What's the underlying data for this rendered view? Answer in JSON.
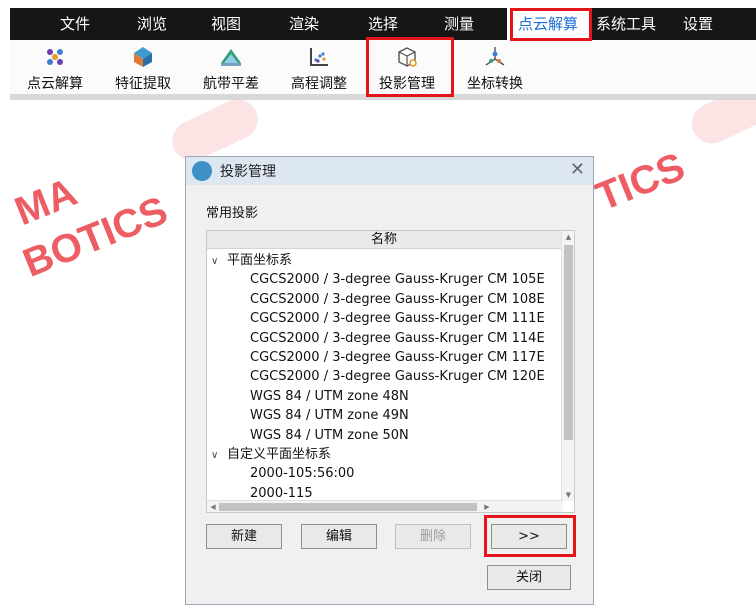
{
  "menu": {
    "items": [
      {
        "label": "文件"
      },
      {
        "label": "浏览"
      },
      {
        "label": "视图"
      },
      {
        "label": "渲染"
      },
      {
        "label": "选择"
      },
      {
        "label": "测量"
      },
      {
        "label": "点云解算",
        "active": true
      },
      {
        "label": "系统工具"
      },
      {
        "label": "设置"
      }
    ]
  },
  "ribbon": {
    "buttons": [
      {
        "label": "点云解算",
        "icon": "point-cloud-solve-icon"
      },
      {
        "label": "特征提取",
        "icon": "feature-extract-icon"
      },
      {
        "label": "航带平差",
        "icon": "strip-adjust-icon"
      },
      {
        "label": "高程调整",
        "icon": "elevation-adjust-icon"
      },
      {
        "label": "投影管理",
        "icon": "projection-manage-icon"
      },
      {
        "label": "坐标转换",
        "icon": "coordinate-transform-icon"
      }
    ]
  },
  "watermark": {
    "line1": "MA",
    "line2": "BOTICS",
    "line3": "TICS"
  },
  "dialog": {
    "title": "投影管理",
    "close_glyph": "✕",
    "section_label": "常用投影",
    "column_header": "名称",
    "groups": [
      {
        "label": "平面坐标系",
        "items": [
          "CGCS2000 / 3-degree Gauss-Kruger CM 105E",
          "CGCS2000 / 3-degree Gauss-Kruger CM 108E",
          "CGCS2000 / 3-degree Gauss-Kruger CM 111E",
          "CGCS2000 / 3-degree Gauss-Kruger CM 114E",
          "CGCS2000 / 3-degree Gauss-Kruger CM 117E",
          "CGCS2000 / 3-degree Gauss-Kruger CM 120E",
          "WGS 84 / UTM zone 48N",
          "WGS 84 / UTM zone 49N",
          "WGS 84 / UTM zone 50N"
        ]
      },
      {
        "label": "自定义平面坐标系",
        "items": [
          "2000-105:56:00",
          "2000-115"
        ]
      }
    ],
    "buttons": {
      "new": "新建",
      "edit": "编辑",
      "delete": "删除",
      "more": ">>",
      "close": "关闭"
    }
  },
  "colors": {
    "highlight": "#e4141b",
    "active_menu_text": "#1b6fd6",
    "watermark": "#e9424a"
  }
}
